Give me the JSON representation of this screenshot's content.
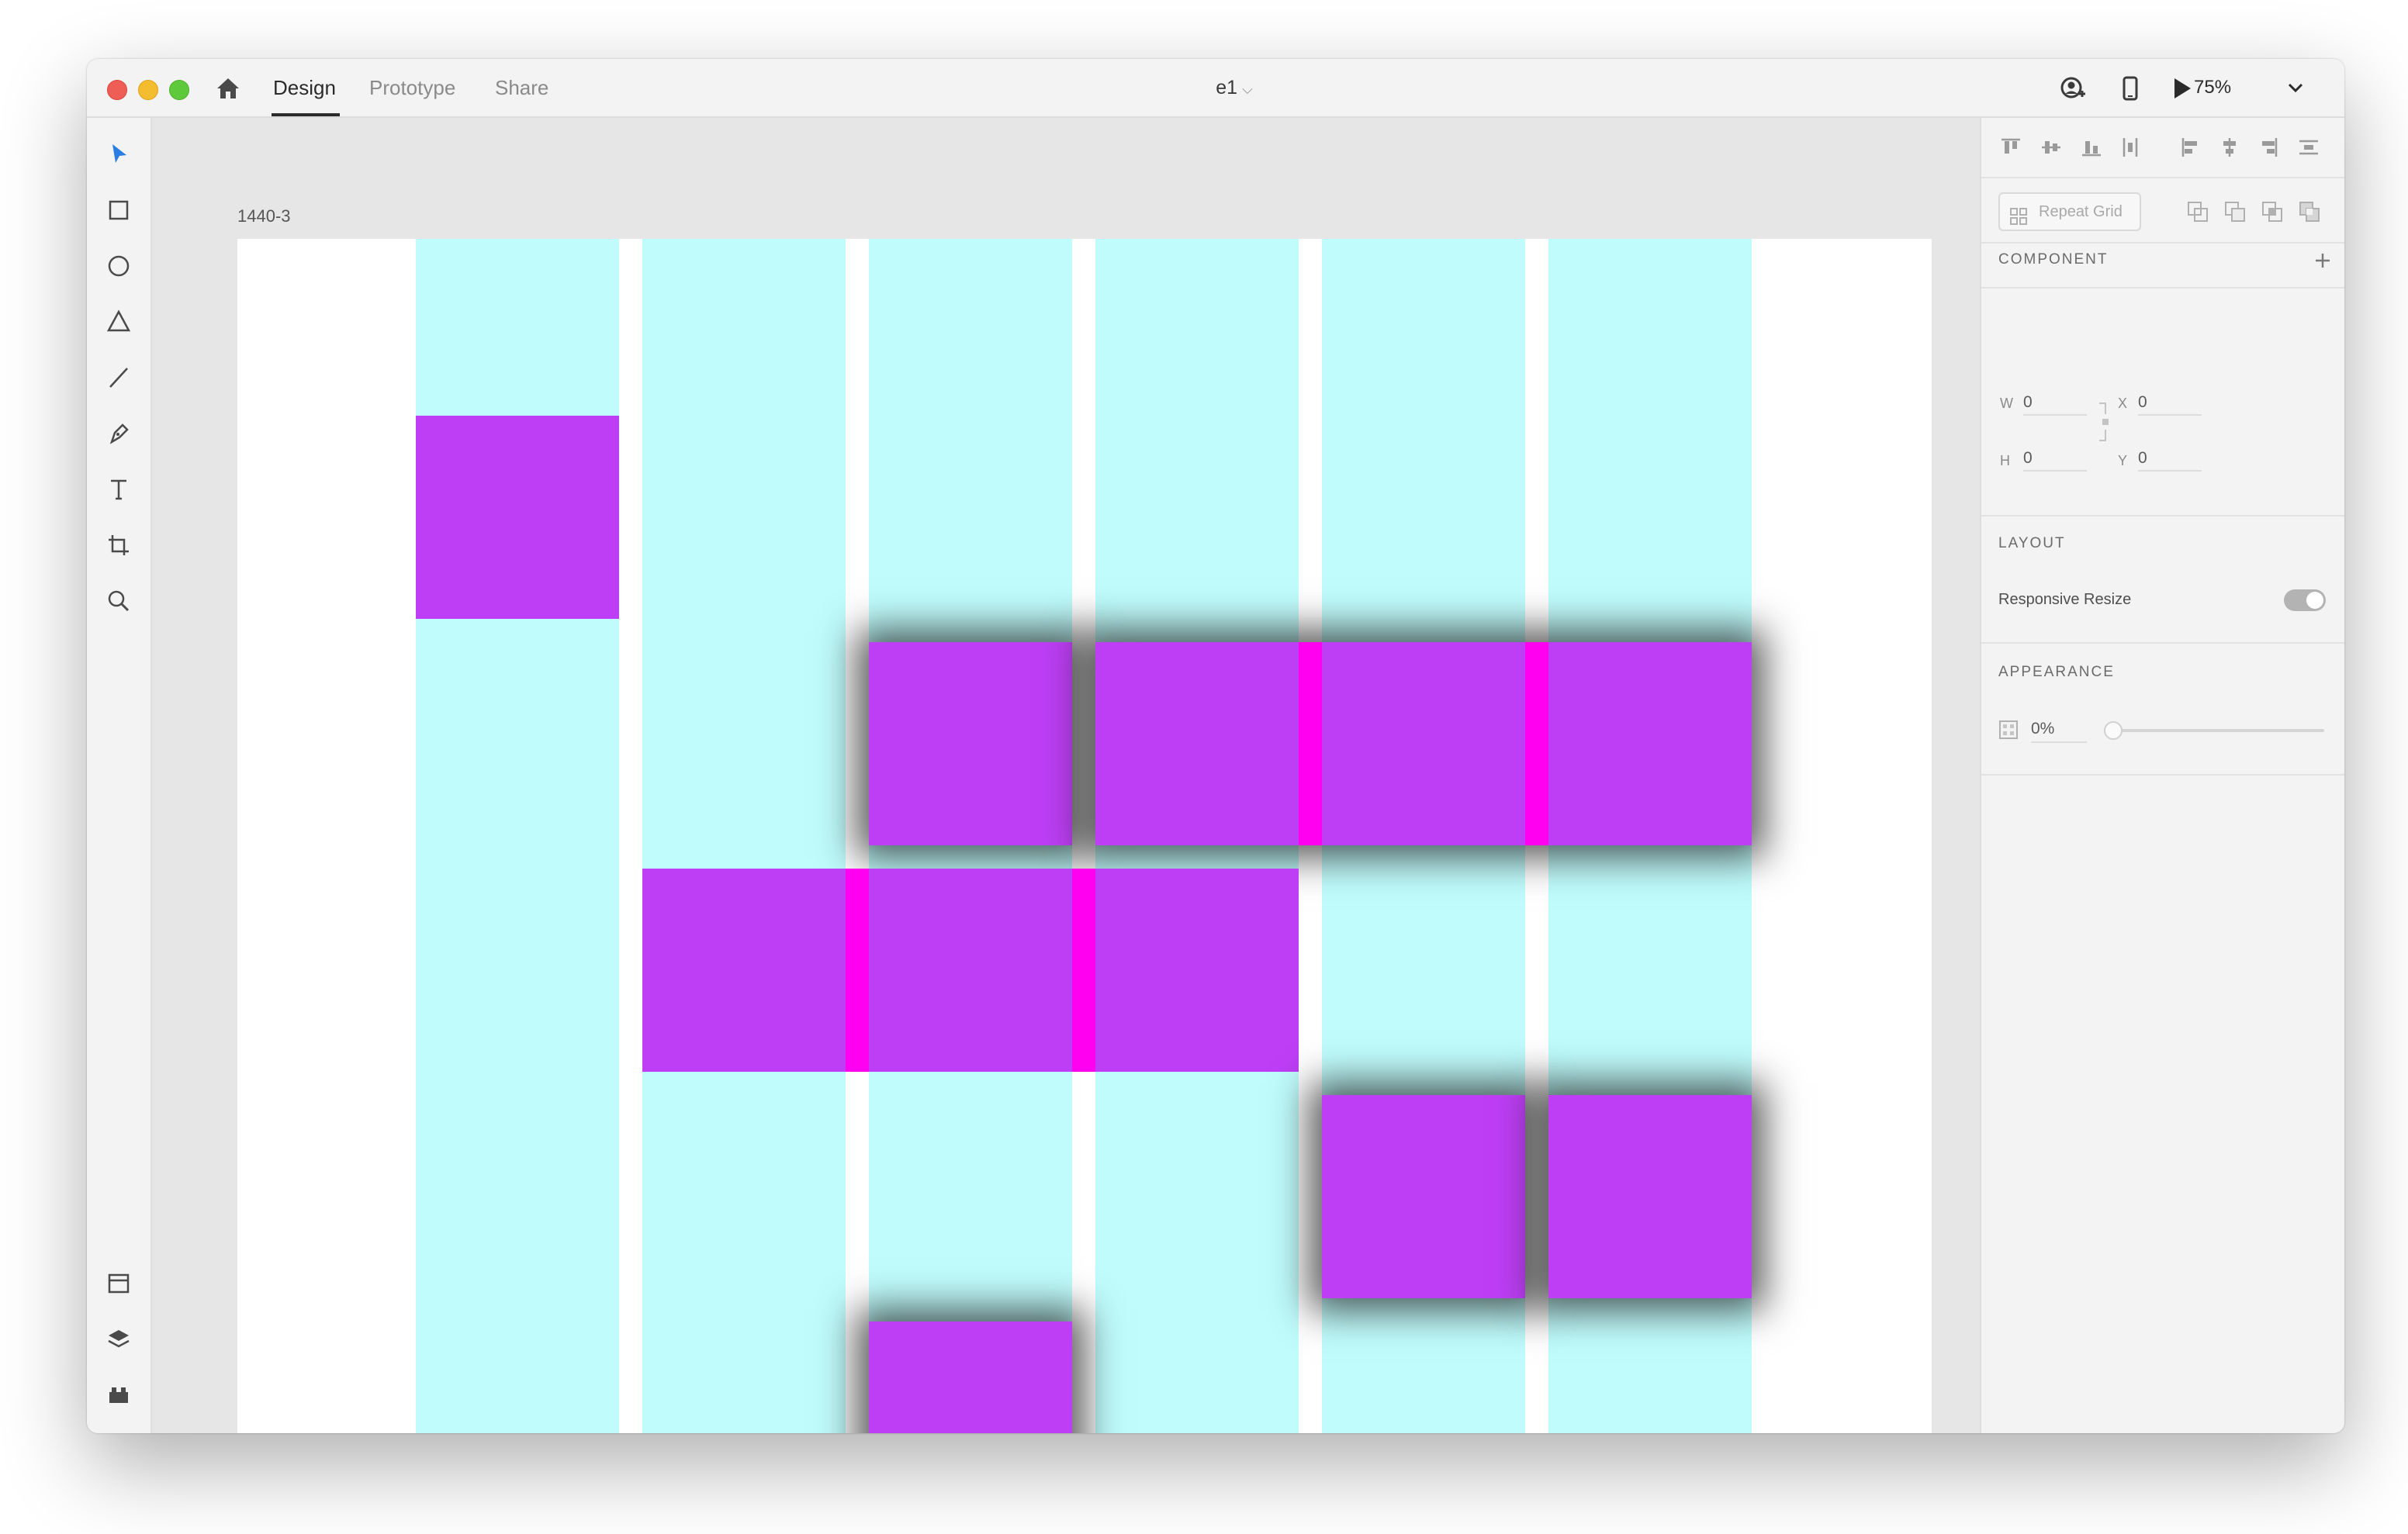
{
  "window": {
    "tabs": [
      {
        "label": "Design",
        "active": true
      },
      {
        "label": "Prototype",
        "active": false
      },
      {
        "label": "Share",
        "active": false
      }
    ],
    "document_title": "e1",
    "zoom": "75%"
  },
  "toolbar": {
    "tools": [
      "select-tool-icon",
      "rectangle-tool-icon",
      "ellipse-tool-icon",
      "polygon-tool-icon",
      "line-tool-icon",
      "pen-tool-icon",
      "text-tool-icon",
      "artboard-tool-icon",
      "zoom-tool-icon"
    ],
    "bottom": [
      "assets-panel-icon",
      "layers-panel-icon",
      "plugins-panel-icon"
    ]
  },
  "canvas": {
    "artboard_name": "1440-3",
    "column_color": "#c0fcfc",
    "square_color": "#be3ef6",
    "gap_color": "#ff00f0"
  },
  "inspector": {
    "repeat_grid_label": "Repeat Grid",
    "component_title": "COMPONENT",
    "fields": {
      "w_label": "W",
      "w": "0",
      "x_label": "X",
      "x": "0",
      "h_label": "H",
      "h": "0",
      "y_label": "Y",
      "y": "0"
    },
    "layout_title": "LAYOUT",
    "responsive_resize_label": "Responsive Resize",
    "responsive_resize_on": true,
    "appearance_title": "APPEARANCE",
    "opacity": "0%"
  }
}
